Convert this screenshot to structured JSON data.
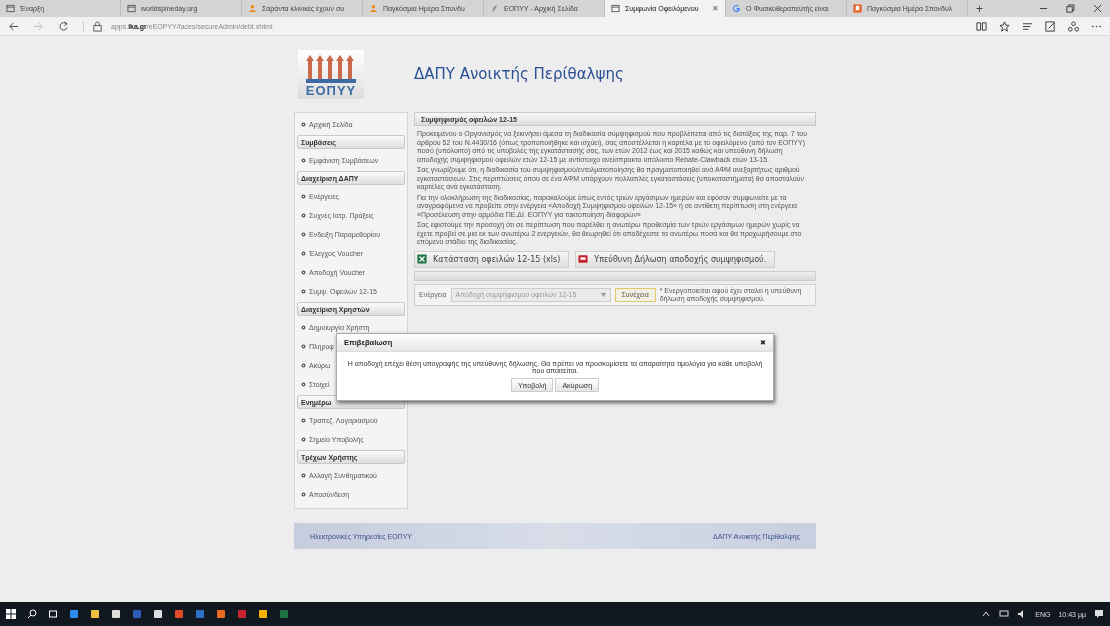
{
  "browser": {
    "tabs": [
      {
        "label": "Έναρξη",
        "kind": "page",
        "selected": false
      },
      {
        "label": "worldspineday.org",
        "kind": "page",
        "selected": false
      },
      {
        "label": "Σαράντα κλινικές έχουν συ",
        "kind": "person",
        "selected": false
      },
      {
        "label": "Παγκόσμια Ημέρα Σπονδυ",
        "kind": "person",
        "selected": false
      },
      {
        "label": "ΕΟΠΥΥ - Αρχική Σελίδα",
        "kind": "leaf",
        "selected": false
      },
      {
        "label": "Συμφωνία Οφειλόμενου",
        "kind": "page",
        "selected": true,
        "close": "✕"
      },
      {
        "label": "Ο Φυσικοθεραπευτής είναι",
        "kind": "google",
        "selected": false
      },
      {
        "label": "Παγκόσμια Ημέρα Σπονδυλ",
        "kind": "square",
        "selected": false
      }
    ],
    "new_tab": "+",
    "address": "apps.**ika.gr**/eEOPYY/faces/secureAdmin/debt.xhtml"
  },
  "header": {
    "logo_text": "ΕΟΠΥΥ",
    "title": "ΔΑΠΥ Ανοικτής Περίθαλψης"
  },
  "sidebar": [
    {
      "kind": "link",
      "label": "Αρχική Σελίδα"
    },
    {
      "kind": "header",
      "label": "Συμβάσεις"
    },
    {
      "kind": "link",
      "label": "Εμφάνιση Συμβάσεων"
    },
    {
      "kind": "header",
      "label": "Διαχείριση ΔΑΠΥ"
    },
    {
      "kind": "link",
      "label": "Ενέργειες"
    },
    {
      "kind": "link",
      "label": "Συχνές Ιατρ. Πράξεις"
    },
    {
      "kind": "link",
      "label": "Ενδειξη Παραμεθορίου"
    },
    {
      "kind": "link",
      "label": "Έλεγχος Voucher"
    },
    {
      "kind": "link",
      "label": "Αποδοχή Voucher"
    },
    {
      "kind": "link",
      "label": "Συμψ. Οφειλών 12-15"
    },
    {
      "kind": "header",
      "label": "Διαχείριση Χρηστών"
    },
    {
      "kind": "link",
      "label": "Δημιουργία Χρήστη"
    },
    {
      "kind": "link",
      "label": "Πληροφ"
    },
    {
      "kind": "link",
      "label": "Ακύρω"
    },
    {
      "kind": "link",
      "label": "Στοιχεί"
    },
    {
      "kind": "header",
      "label": "Ενημέρω"
    },
    {
      "kind": "link",
      "label": "Τραπεζ. Λογαριασμού"
    },
    {
      "kind": "link",
      "label": "Σημεία Υποβολής"
    },
    {
      "kind": "header",
      "label": "Τρέχων Χρήστης"
    },
    {
      "kind": "link",
      "label": "Αλλαγή Συνθηματικού"
    },
    {
      "kind": "link",
      "label": "Αποσύνδεση"
    }
  ],
  "content": {
    "title": "Συμψηφισμός οφειλών 12-15",
    "paragraphs": [
      "Προκειμένου ο Οργανισμός να ξεκινήσει άμεσα τη διαδικασία συμψηφισμού που προβλέπεται από τις διατάξεις της παρ. 7 του άρθρου 52 του Ν.4430/16 (όπως τροποποιήθηκε και ισχύει), σας αποστέλλεται η καρτέλα με το οφειλόμενο (από τον ΕΟΠΥΥ) ποσό (υπόλοιπο) από τις υποβολές της εγκατάστασής σας, των ετών 2012 έως και 2015 καθώς και υπεύθυνη δήλωση αποδοχής συμψηφισμού οφειλών ετών 12-15 με αντίστοιχο ανείσπρακτο υπόλοιπο Rebate-Clawback ετών 13-15.",
      "Σας γνωρίζουμε ότι, η διαδικασία του συμψηφισμού/εντολματοποίησης θα πραγματοποιηθεί ανά ΑΦΜ ανεξαρτήτως αριθμού εγκαταστάσεων. Στις περιπτώσεις όπου σε ένα ΑΦΜ υπάρχουν πολλαπλές εγκαταστάσεις (υποκαταστήματα) θα αποσταλούν καρτέλες ανά εγκατάσταση.",
      "Για την ολοκλήρωση της διαδικασίας, παρακαλούμε όπως εντός τριών εργάσιμων ημερών και εφόσον συμφωνείτε με τα αναγραφόμενα να προβείτε στην ενέργεια «Αποδοχή Συμψηφισμού οφειλών 12-15» ή σε αντίθετη περίπτωση στη ενέργεια «Προσέλευση στην αρμόδια ΠΕ.ΔΙ. ΕΟΠΥΥ για τακτοποίηση διαφορών»",
      "Σας εφιστούμε την προσοχή ότι σε περίπτωση που παρέλθει η ανωτέρω προθεσμία των τριών εργάσιμων ημερών χωρίς να έχετε προβεί σε μια εκ των ανωτέρω 2 ενεργειών, θα θεωρηθεί ότι αποδέχεστε τα ανωτέρω ποσά και θα προχωρήσουμε στο επόμενο στάδιο της διαδικασίας."
    ],
    "downloads": [
      {
        "kind": "xls",
        "label": "Κατάσταση οφειλών 12-15 (xls)"
      },
      {
        "kind": "pdf",
        "label": "Υπεύθυνη Δήλωση αποδοχής συμψηφισμού."
      }
    ],
    "action": {
      "label": "Ενέργεια",
      "value": "Αποδοχή συμψηφισμού οφειλών 12-15",
      "disabled": true,
      "button": "Συνέχεια",
      "note": "* Ενεργοποιείται αφού έχει σταλεί η υπεύθυνη δήλωση αποδοχής συμψηφισμού."
    }
  },
  "dialog": {
    "title": "Επιβεβαίωση",
    "close": "✖",
    "message": "Η αποδοχή επέχει θέση υπογραφής της υπεύθυνης δήλωσης. Θα πρέπει να προσκομίσετε τα απαραίτητα τιμολόγια για κάθε υποβολή που απαιτείται.",
    "buttons": [
      "Υποβολή",
      "Ακύρωση"
    ]
  },
  "footer": {
    "left": "Ηλεκτρονικές Υπηρεσίες ΕΟΠΥΥ",
    "right": "ΔΑΠΥ Ανοικτής Περίθαλψης"
  },
  "taskbar": {
    "language": "ENG",
    "time": "10:43 μμ"
  }
}
